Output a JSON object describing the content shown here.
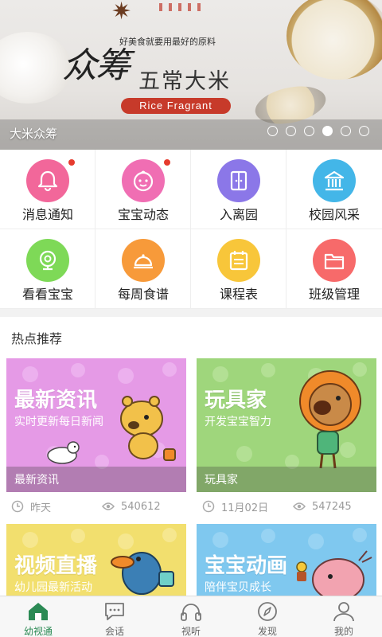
{
  "banner": {
    "tagline": "好美食就要用最好的原料",
    "title_big": "众筹",
    "title_sub": "五常大米",
    "pill": "Rice  Fragrant",
    "caption": "大米众筹",
    "indicator_count": 6,
    "active_indicator": 3
  },
  "grid": {
    "items": [
      {
        "label": "消息通知",
        "icon": "bell-icon",
        "color": "#f2679a",
        "badge": true
      },
      {
        "label": "宝宝动态",
        "icon": "baby-face-icon",
        "color": "#f06eb3",
        "badge": true
      },
      {
        "label": "入离园",
        "icon": "door-icon",
        "color": "#8b77e8",
        "badge": false
      },
      {
        "label": "校园风采",
        "icon": "building-icon",
        "color": "#43b6e8",
        "badge": false
      },
      {
        "label": "看看宝宝",
        "icon": "camera-icon",
        "color": "#7ed957",
        "badge": false
      },
      {
        "label": "每周食谱",
        "icon": "food-cover-icon",
        "color": "#f79a3a",
        "badge": false
      },
      {
        "label": "课程表",
        "icon": "schedule-icon",
        "color": "#f8c63a",
        "badge": false
      },
      {
        "label": "班级管理",
        "icon": "folder-icon",
        "color": "#f76a6a",
        "badge": false
      }
    ]
  },
  "hot": {
    "title": "热点推荐",
    "cards": [
      {
        "title": "最新资讯",
        "sub": "实时更新每日新闻",
        "strip": "最新资讯",
        "date": "昨天",
        "views": "540612",
        "bg": "#e59ae6"
      },
      {
        "title": "玩具家",
        "sub": "开发宝宝智力",
        "strip": "玩具家",
        "date": "11月02日",
        "views": "547245",
        "bg": "#9fd67c"
      },
      {
        "title": "视频直播",
        "sub": "幼儿园最新活动",
        "strip": "",
        "date": "",
        "views": "",
        "bg": "#f2df6e"
      },
      {
        "title": "宝宝动画",
        "sub": "陪伴宝贝成长",
        "strip": "",
        "date": "",
        "views": "",
        "bg": "#7fc8ef"
      }
    ]
  },
  "tabbar": {
    "tabs": [
      {
        "label": "幼视通",
        "icon": "home-icon",
        "active": true
      },
      {
        "label": "会话",
        "icon": "chat-icon",
        "active": false
      },
      {
        "label": "视听",
        "icon": "headphones-icon",
        "active": false
      },
      {
        "label": "发现",
        "icon": "compass-icon",
        "active": false
      },
      {
        "label": "我的",
        "icon": "user-icon",
        "active": false
      }
    ]
  },
  "colors": {
    "accent": "#2b8a54",
    "badge": "#e63b2e",
    "pill": "#c73a2a"
  }
}
